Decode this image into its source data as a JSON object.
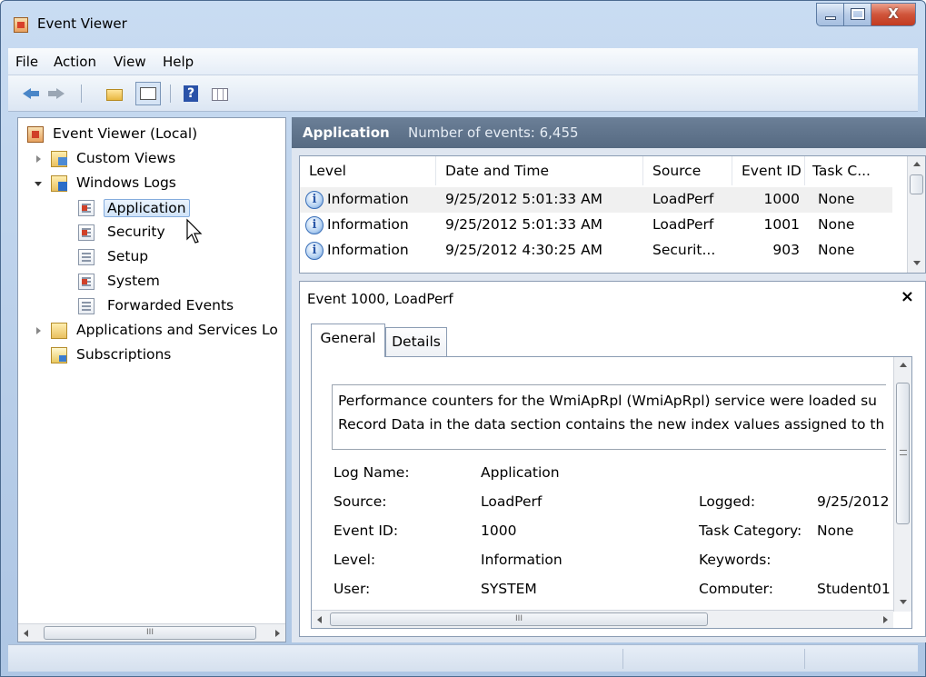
{
  "window": {
    "title": "Event Viewer"
  },
  "menu": [
    "File",
    "Action",
    "View",
    "Help"
  ],
  "tree": {
    "root": "Event Viewer (Local)",
    "custom_views": "Custom Views",
    "windows_logs": "Windows Logs",
    "logs": [
      "Application",
      "Security",
      "Setup",
      "System",
      "Forwarded Events"
    ],
    "apps_services": "Applications and Services Lo",
    "subscriptions": "Subscriptions",
    "selected": "Application"
  },
  "scroll_grip": "III",
  "header": {
    "log_name": "Application",
    "count": "Number of events: 6,455"
  },
  "events": {
    "columns": [
      "Level",
      "Date and Time",
      "Source",
      "Event ID",
      "Task C..."
    ],
    "rows": [
      {
        "level": "Information",
        "date": "9/25/2012 5:01:33 AM",
        "source": "LoadPerf",
        "event_id": "1000",
        "task": "None"
      },
      {
        "level": "Information",
        "date": "9/25/2012 5:01:33 AM",
        "source": "LoadPerf",
        "event_id": "1001",
        "task": "None"
      },
      {
        "level": "Information",
        "date": "9/25/2012 4:30:25 AM",
        "source": "Securit...",
        "event_id": "903",
        "task": "None"
      }
    ],
    "info_glyph": "i"
  },
  "detail": {
    "title": "Event 1000, LoadPerf",
    "close": "×",
    "tabs": [
      "General",
      "Details"
    ],
    "description_lines": [
      "Performance counters for the WmiApRpl (WmiApRpl) service were loaded su",
      "Record Data in the data section contains the new index values assigned to th"
    ],
    "fields": {
      "log_name_label": "Log Name:",
      "log_name": "Application",
      "source_label": "Source:",
      "source": "LoadPerf",
      "event_id_label": "Event ID:",
      "event_id": "1000",
      "level_label": "Level:",
      "level": "Information",
      "user_label": "User:",
      "user": "SYSTEM",
      "logged_label": "Logged:",
      "logged": "9/25/2012",
      "task_category_label": "Task Category:",
      "task_category": "None",
      "keywords_label": "Keywords:",
      "keywords": "",
      "computer_label": "Computer:",
      "computer": "Student01"
    }
  },
  "icons": {
    "back": "back-arrow-icon",
    "forward": "forward-arrow-icon",
    "up_folder": "folder-up-icon",
    "show_hide": "console-tree-icon",
    "help": "help-icon",
    "action_pane": "action-pane-icon"
  }
}
